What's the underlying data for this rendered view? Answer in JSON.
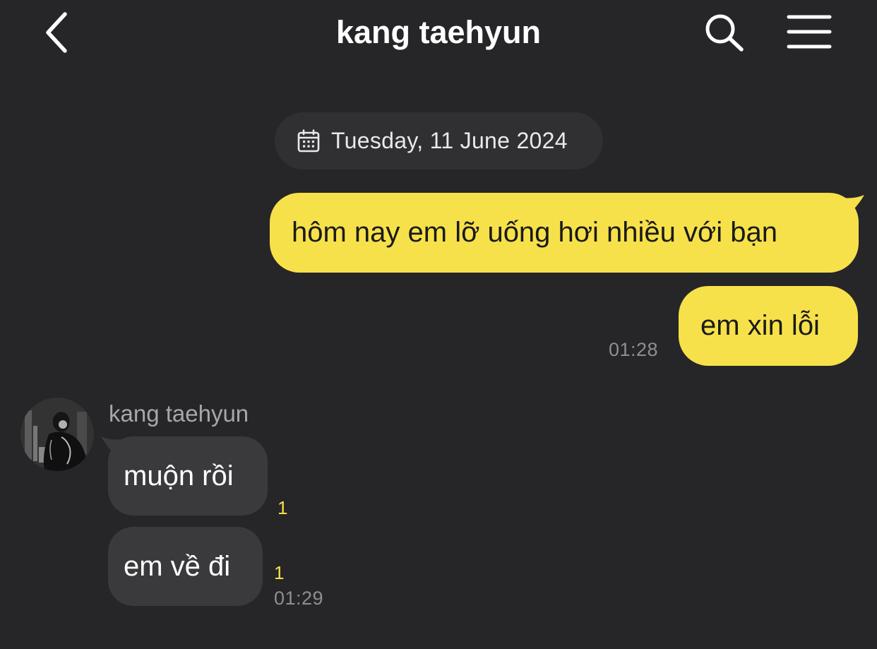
{
  "header": {
    "title": "kang taehyun",
    "back_icon": "chevron-left-icon",
    "search_icon": "search-icon",
    "menu_icon": "hamburger-menu-icon"
  },
  "date_divider": {
    "icon": "calendar-icon",
    "text": "Tuesday, 11 June 2024"
  },
  "messages_out": [
    {
      "text": "hôm nay em lỡ uống hơi nhiều với bạn"
    },
    {
      "text": "em xin lỗi",
      "time": "01:28"
    }
  ],
  "incoming": {
    "sender": "kang taehyun",
    "avatar_icon": "profile-photo",
    "messages": [
      {
        "text": "muộn rồi",
        "unread": "1"
      },
      {
        "text": "em về đi",
        "unread": "1",
        "time": "01:29"
      }
    ]
  },
  "colors": {
    "background": "#262628",
    "outgoing_bubble": "#f7e14a",
    "incoming_bubble": "#3a3a3d",
    "date_pill": "#303033",
    "unread_count": "#f7e14a",
    "timestamp": "#8e8e93"
  }
}
